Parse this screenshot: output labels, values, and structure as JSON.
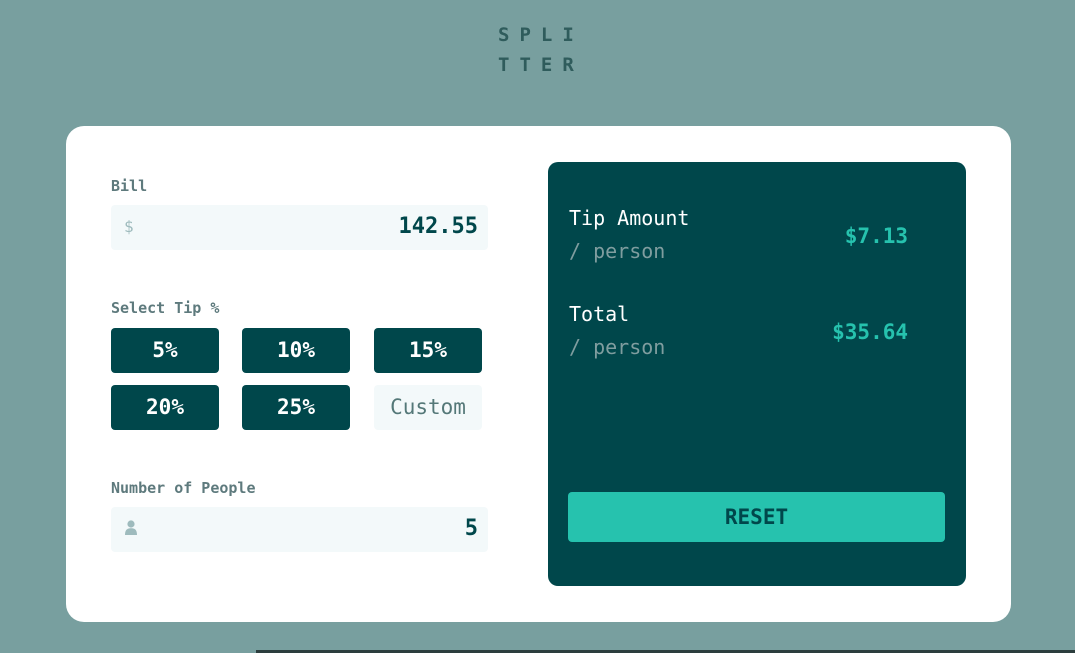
{
  "logo": {
    "line1": "SPLI",
    "line2": "TTER"
  },
  "bill": {
    "label": "Bill",
    "currency_symbol": "$",
    "value": "142.55"
  },
  "tip": {
    "label": "Select Tip %",
    "options": [
      "5%",
      "10%",
      "15%",
      "20%",
      "25%"
    ],
    "custom_placeholder": "Custom"
  },
  "people": {
    "label": "Number of People",
    "value": "5",
    "icon": "person-icon"
  },
  "results": {
    "tip_title": "Tip Amount",
    "tip_sub": "/ person",
    "tip_value": "$7.13",
    "total_title": "Total",
    "total_sub": "/ person",
    "total_value": "$35.64",
    "reset_label": "RESET"
  },
  "colors": {
    "background": "#789f9f",
    "dark_cyan": "#00474b",
    "accent": "#26c2ae",
    "input_bg": "#f3f9fa"
  }
}
